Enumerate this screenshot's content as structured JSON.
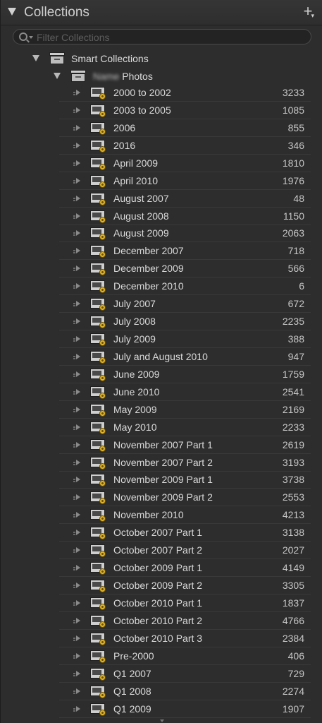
{
  "panel": {
    "title": "Collections",
    "add_label": "+",
    "add_menu_caret": "▾"
  },
  "search": {
    "placeholder": "Filter Collections"
  },
  "tree": {
    "smart_collections_label": "Smart Collections",
    "photos_owner_blurred": "Name",
    "photos_label": "Photos"
  },
  "collections": [
    {
      "name": "2000 to 2002",
      "count": "3233"
    },
    {
      "name": "2003 to 2005",
      "count": "1085"
    },
    {
      "name": "2006",
      "count": "855"
    },
    {
      "name": "2016",
      "count": "346"
    },
    {
      "name": "April 2009",
      "count": "1810"
    },
    {
      "name": "April 2010",
      "count": "1976"
    },
    {
      "name": "August 2007",
      "count": "48"
    },
    {
      "name": "August 2008",
      "count": "1150"
    },
    {
      "name": "August 2009",
      "count": "2063"
    },
    {
      "name": "December 2007",
      "count": "718"
    },
    {
      "name": "December 2009",
      "count": "566"
    },
    {
      "name": "December 2010",
      "count": "6"
    },
    {
      "name": "July 2007",
      "count": "672"
    },
    {
      "name": "July 2008",
      "count": "2235"
    },
    {
      "name": "July 2009",
      "count": "388"
    },
    {
      "name": "July and August 2010",
      "count": "947"
    },
    {
      "name": "June 2009",
      "count": "1759"
    },
    {
      "name": "June 2010",
      "count": "2541"
    },
    {
      "name": "May 2009",
      "count": "2169"
    },
    {
      "name": "May 2010",
      "count": "2233"
    },
    {
      "name": "November 2007 Part 1",
      "count": "2619"
    },
    {
      "name": "November 2007 Part 2",
      "count": "3193"
    },
    {
      "name": "November 2009 Part 1",
      "count": "3738"
    },
    {
      "name": "November 2009 Part 2",
      "count": "2553"
    },
    {
      "name": "November 2010",
      "count": "4213"
    },
    {
      "name": "October 2007 Part 1",
      "count": "3138"
    },
    {
      "name": "October 2007 Part 2",
      "count": "2027"
    },
    {
      "name": "October 2009 Part 1",
      "count": "4149"
    },
    {
      "name": "October 2009 Part 2",
      "count": "3305"
    },
    {
      "name": "October 2010 Part 1",
      "count": "1837"
    },
    {
      "name": "October 2010 Part 2",
      "count": "4766"
    },
    {
      "name": "October 2010 Part 3",
      "count": "2384"
    },
    {
      "name": "Pre-2000",
      "count": "406"
    },
    {
      "name": "Q1 2007",
      "count": "729"
    },
    {
      "name": "Q1 2008",
      "count": "2274"
    },
    {
      "name": "Q1 2009",
      "count": "1907"
    }
  ],
  "colors": {
    "panel_bg": "#2d2d2d",
    "text": "#dadada",
    "smart_badge": "#e0b52a"
  }
}
